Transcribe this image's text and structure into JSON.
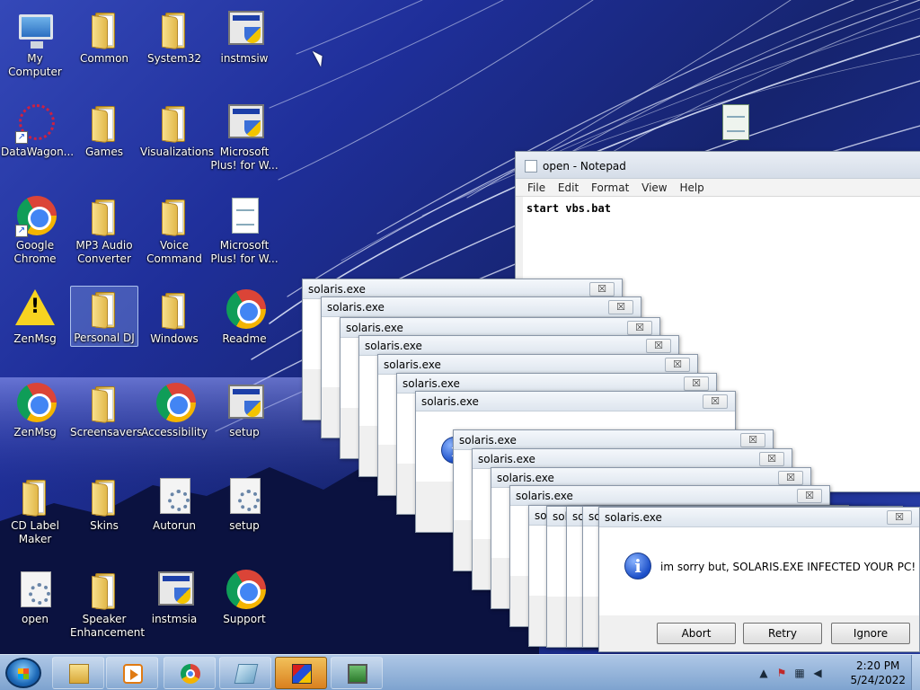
{
  "desktop": {
    "icons": [
      {
        "label": "My Computer",
        "icon": "computer-icon"
      },
      {
        "label": "Common",
        "icon": "folder-icon"
      },
      {
        "label": "System32",
        "icon": "folder-icon"
      },
      {
        "label": "instmsiw",
        "icon": "installer-icon"
      },
      {
        "label": "DataWagon...",
        "icon": "datawagon-icon"
      },
      {
        "label": "Games",
        "icon": "folder-icon"
      },
      {
        "label": "Visualizations",
        "icon": "folder-icon"
      },
      {
        "label": "Microsoft Plus! for W...",
        "icon": "installer-icon"
      },
      {
        "label": "Google Chrome",
        "icon": "chrome-icon"
      },
      {
        "label": "MP3 Audio Converter",
        "icon": "folder-icon"
      },
      {
        "label": "Voice Command",
        "icon": "folder-icon"
      },
      {
        "label": "Microsoft Plus! for W...",
        "icon": "document-icon"
      },
      {
        "label": "ZenMsg",
        "icon": "warning-icon"
      },
      {
        "label": "Personal DJ",
        "icon": "folder-icon"
      },
      {
        "label": "Windows",
        "icon": "folder-icon"
      },
      {
        "label": "Readme",
        "icon": "chrome-icon"
      },
      {
        "label": "ZenMsg",
        "icon": "chrome-icon"
      },
      {
        "label": "Screensavers",
        "icon": "folder-icon"
      },
      {
        "label": "Accessibility",
        "icon": "chrome-icon"
      },
      {
        "label": "setup",
        "icon": "installer-icon"
      },
      {
        "label": "CD Label Maker",
        "icon": "folder-icon"
      },
      {
        "label": "Skins",
        "icon": "folder-icon"
      },
      {
        "label": "Autorun",
        "icon": "gear-icon"
      },
      {
        "label": "setup",
        "icon": "gear-icon"
      },
      {
        "label": "open",
        "icon": "gear-icon"
      },
      {
        "label": "Speaker Enhancement",
        "icon": "folder-icon"
      },
      {
        "label": "instmsia",
        "icon": "installer-icon"
      },
      {
        "label": "Support",
        "icon": "chrome-icon"
      }
    ]
  },
  "notepad": {
    "title": "open - Notepad",
    "menu": [
      "File",
      "Edit",
      "Format",
      "View",
      "Help"
    ],
    "content": "start vbs.bat"
  },
  "dialogs": {
    "title": "solaris.exe",
    "close_glyph": "☒",
    "message": "im sorry but, SOLARIS.EXE INFECTED YOUR PC!",
    "buttons": [
      "Abort",
      "Retry",
      "Ignore"
    ]
  },
  "taskbar": {
    "pinned": [
      "file-explorer",
      "media-player",
      "google-chrome",
      "visual-studio",
      "3d-cube-app",
      "screen-app"
    ],
    "active_index": 4,
    "tray": {
      "time": "2:20 PM",
      "date": "5/24/2022",
      "icons": [
        "show-hidden-icons-icon",
        "action-center-flag-icon",
        "network-icon",
        "volume-icon"
      ]
    }
  }
}
